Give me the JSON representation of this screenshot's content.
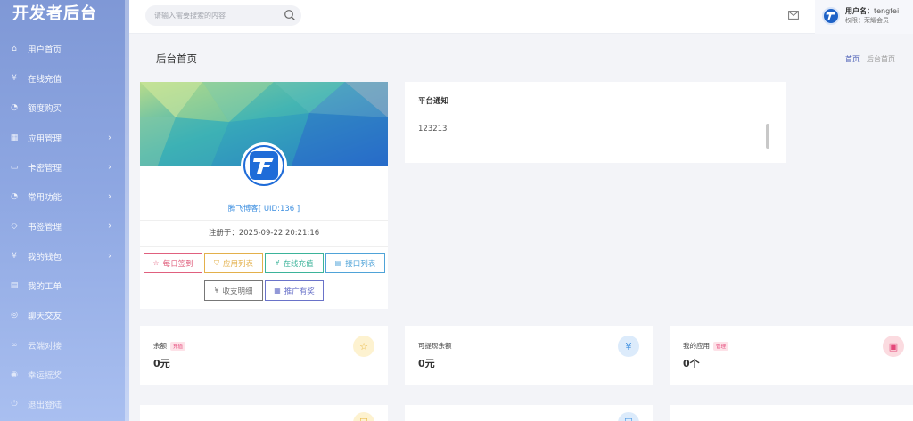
{
  "brand": "开发者后台",
  "sidebar": {
    "items": [
      {
        "label": "用户首页",
        "icon": "home-icon",
        "has_arrow": false
      },
      {
        "label": "在线充值",
        "icon": "yen-icon",
        "has_arrow": false
      },
      {
        "label": "额度购买",
        "icon": "dashboard-icon",
        "has_arrow": false
      },
      {
        "label": "应用管理",
        "icon": "apps-icon",
        "has_arrow": true
      },
      {
        "label": "卡密管理",
        "icon": "card-icon",
        "has_arrow": true
      },
      {
        "label": "常用功能",
        "icon": "gauge-icon",
        "has_arrow": true
      },
      {
        "label": "书签管理",
        "icon": "tag-icon",
        "has_arrow": true
      },
      {
        "label": "我的钱包",
        "icon": "wallet-icon",
        "has_arrow": true
      },
      {
        "label": "我的工单",
        "icon": "ticket-icon",
        "has_arrow": false
      },
      {
        "label": "聊天交友",
        "icon": "chat-icon",
        "has_arrow": false
      },
      {
        "label": "云端对接",
        "icon": "link-icon",
        "has_arrow": false
      },
      {
        "label": "幸运摇奖",
        "icon": "lottery-icon",
        "has_arrow": false
      },
      {
        "label": "退出登陆",
        "icon": "logout-icon",
        "has_arrow": false
      }
    ]
  },
  "header": {
    "search_placeholder": "请输入需要搜索的内容",
    "user_name_label": "用户名：",
    "user_name": "tengfei",
    "user_role": "权限：荣耀会员"
  },
  "page": {
    "title": "后台首页",
    "breadcrumb": [
      "首页",
      "后台首页"
    ]
  },
  "profile": {
    "name": "腾飞博客[ UID:136 ]",
    "registered": "注册于：2025-09-22 20:21:16",
    "buttons": [
      {
        "label": "每日签到",
        "color": "#e0607e",
        "icon": "star-icon"
      },
      {
        "label": "应用列表",
        "color": "#e3b04b",
        "icon": "shield-icon"
      },
      {
        "label": "在线充值",
        "color": "#3bb39a",
        "icon": "yen-icon"
      },
      {
        "label": "接口列表",
        "color": "#4fa3d8",
        "icon": "clipboard-icon"
      },
      {
        "label": "收支明细",
        "color": "#777777",
        "icon": "yen-icon"
      },
      {
        "label": "推广有奖",
        "color": "#6a73c9",
        "icon": "gift-icon"
      }
    ]
  },
  "notice": {
    "title": "平台通知",
    "body": "123213"
  },
  "stats": [
    {
      "label": "余额",
      "tag": "充值",
      "value": "0元",
      "icon": "star-icon",
      "icon_bg": "#fdf2d0",
      "icon_color": "#e8b43a"
    },
    {
      "label": "可提现余额",
      "tag": "",
      "value": "0元",
      "icon": "yen-icon",
      "icon_bg": "#dcebfb",
      "icon_color": "#3d8fe0"
    },
    {
      "label": "我的应用",
      "tag": "管理",
      "value": "0个",
      "icon": "apps-icon",
      "icon_bg": "#fbdbe0",
      "icon_color": "#e4487a"
    }
  ],
  "stats_row2": [
    {
      "icon": "shield-icon",
      "icon_color": "#e8b43a"
    },
    {
      "icon": "shield-icon",
      "icon_color": "#3d8fe0"
    },
    {
      "icon": "apps-icon",
      "icon_color": "#e4487a"
    }
  ]
}
